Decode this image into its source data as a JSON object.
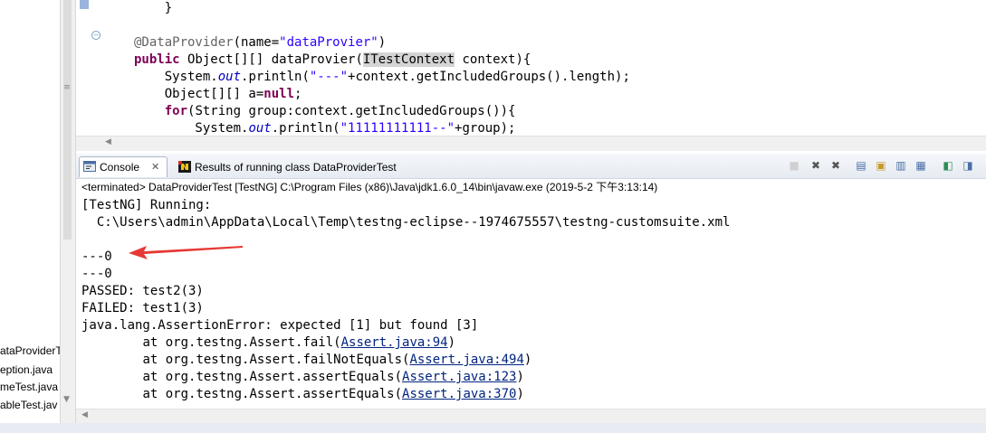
{
  "explorer": {
    "items": [
      "ataProviderT",
      "eption.java",
      "meTest.java",
      "ableTest.jav"
    ]
  },
  "editor": {
    "lines": [
      "    }",
      "",
      "@DataProvider(name=\"dataProvier\")",
      "public Object[][] dataProvier(ITestContext context){",
      "    System.out.println(\"---\"+context.getIncludedGroups().length);",
      "    Object[][] a=null;",
      "    for(String group:context.getIncludedGroups()){",
      "        System.out.println(\"11111111111--\"+group);"
    ]
  },
  "tabs": {
    "console": "Console",
    "console_close": "✕",
    "results": "Results of running class DataProviderTest"
  },
  "console": {
    "status": "<terminated> DataProviderTest [TestNG] C:\\Program Files (x86)\\Java\\jdk1.6.0_14\\bin\\javaw.exe (2019-5-2 下午3:13:14)",
    "lines": {
      "l1": "[TestNG] Running:",
      "l2": "  C:\\Users\\admin\\AppData\\Local\\Temp\\testng-eclipse--1974675557\\testng-customsuite.xml",
      "l3": "",
      "l4": "---0",
      "l5": "---0",
      "l6": "PASSED: test2(3)",
      "l7": "FAILED: test1(3)",
      "l8": "java.lang.AssertionError: expected [1] but found [3]",
      "l9_pre": "\tat org.testng.Assert.fail(",
      "l9_link": "Assert.java:94",
      "l10_pre": "\tat org.testng.Assert.failNotEquals(",
      "l10_link": "Assert.java:494",
      "l11_pre": "\tat org.testng.Assert.assertEquals(",
      "l11_link": "Assert.java:123",
      "l12_pre": "\tat org.testng.Assert.assertEquals(",
      "l12_link": "Assert.java:370",
      "close_paren": ")"
    }
  },
  "icons": {
    "console": "console-icon",
    "results": "testng-icon",
    "annotation": "red-arrow-icon"
  },
  "colors": {
    "keyword": "#7f0055",
    "string": "#2a00ff",
    "link": "#01247f",
    "arrow": "#e53935"
  }
}
